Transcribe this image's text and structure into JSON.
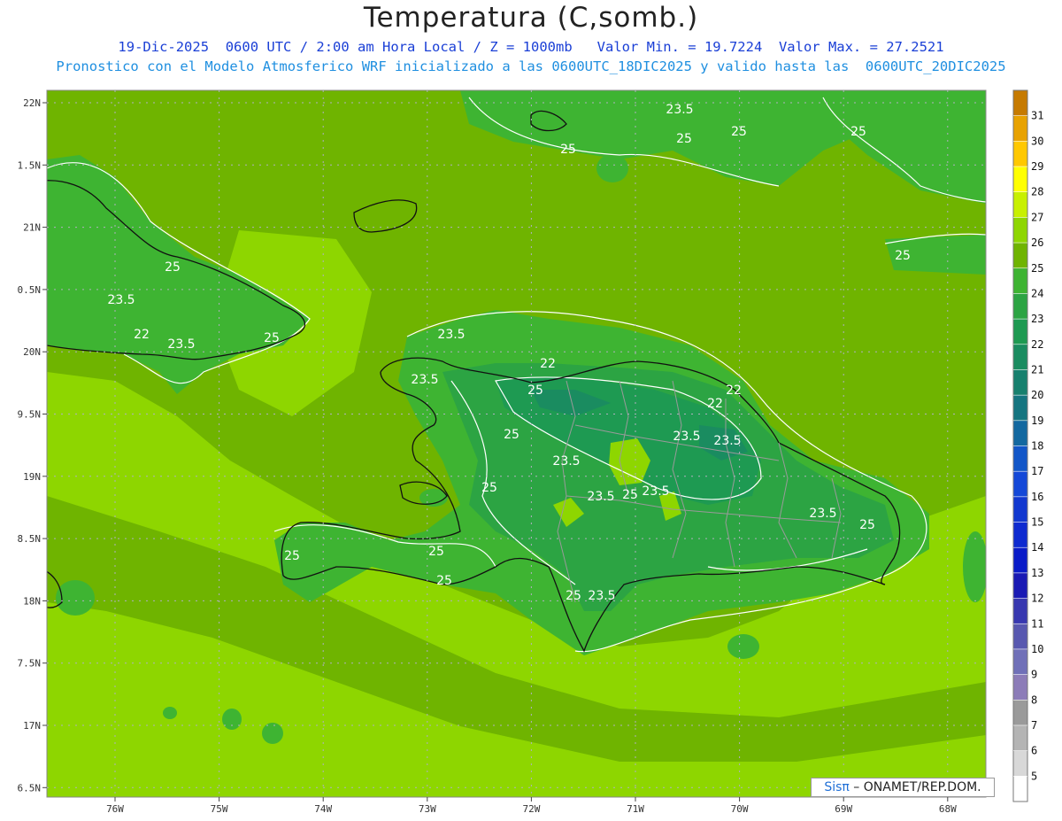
{
  "title": "Temperatura (C,somb.)",
  "subtitle1": "19-Dic-2025  0600 UTC / 2:00 am Hora Local / Z = 1000mb   Valor Min. = 19.7224  Valor Max. = 27.2521",
  "subtitle2": "Pronostico con el Modelo Atmosferico WRF inicializado a las 0600UTC_18DIC2025 y valido hasta las  0600UTC_20DIC2025",
  "credit": {
    "brand": "Sisπ",
    "rest": " – ONAMET/REP.DOM."
  },
  "map": {
    "lat_labels": [
      "22N",
      "1.5N",
      "21N",
      "0.5N",
      "20N",
      "9.5N",
      "19N",
      "8.5N",
      "18N",
      "7.5N",
      "17N",
      "6.5N"
    ],
    "lon_labels": [
      "76W",
      "75W",
      "74W",
      "73W",
      "72W",
      "71W",
      "70W",
      "69W",
      "68W"
    ],
    "contour_labels": [
      "23.5",
      "25",
      "25",
      "25",
      "25",
      "25",
      "23.5",
      "22",
      "23.5",
      "25",
      "25",
      "23.5",
      "22",
      "25",
      "23.5",
      "22",
      "22",
      "23.5",
      "23.5",
      "25",
      "23.5",
      "25",
      "23.5",
      "23.5",
      "25",
      "25",
      "25",
      "25",
      "23.5",
      "25",
      "23.5",
      "25"
    ]
  },
  "colorbar": {
    "levels": [
      "31",
      "30",
      "29",
      "28",
      "27",
      "26",
      "25",
      "24",
      "23",
      "22",
      "21",
      "20",
      "19",
      "18",
      "17",
      "16",
      "15",
      "14",
      "13",
      "12",
      "11",
      "10",
      "9",
      "8",
      "7",
      "6",
      "5"
    ],
    "colors": [
      "#c67a00",
      "#e8a200",
      "#ffc800",
      "#ffff00",
      "#c8f000",
      "#8ed600",
      "#6fb400",
      "#3eb432",
      "#2ca443",
      "#1e9a52",
      "#1a8c60",
      "#17806e",
      "#157580",
      "#1368a0",
      "#1256c8",
      "#1448d8",
      "#1238d0",
      "#0e2ad0",
      "#0a1bc8",
      "#1a1ab4",
      "#3838b0",
      "#5858b0",
      "#7070b8",
      "#8c7cb8",
      "#9a9a9a",
      "#b4b4b4",
      "#d8d8d8",
      "#ffffff"
    ]
  }
}
